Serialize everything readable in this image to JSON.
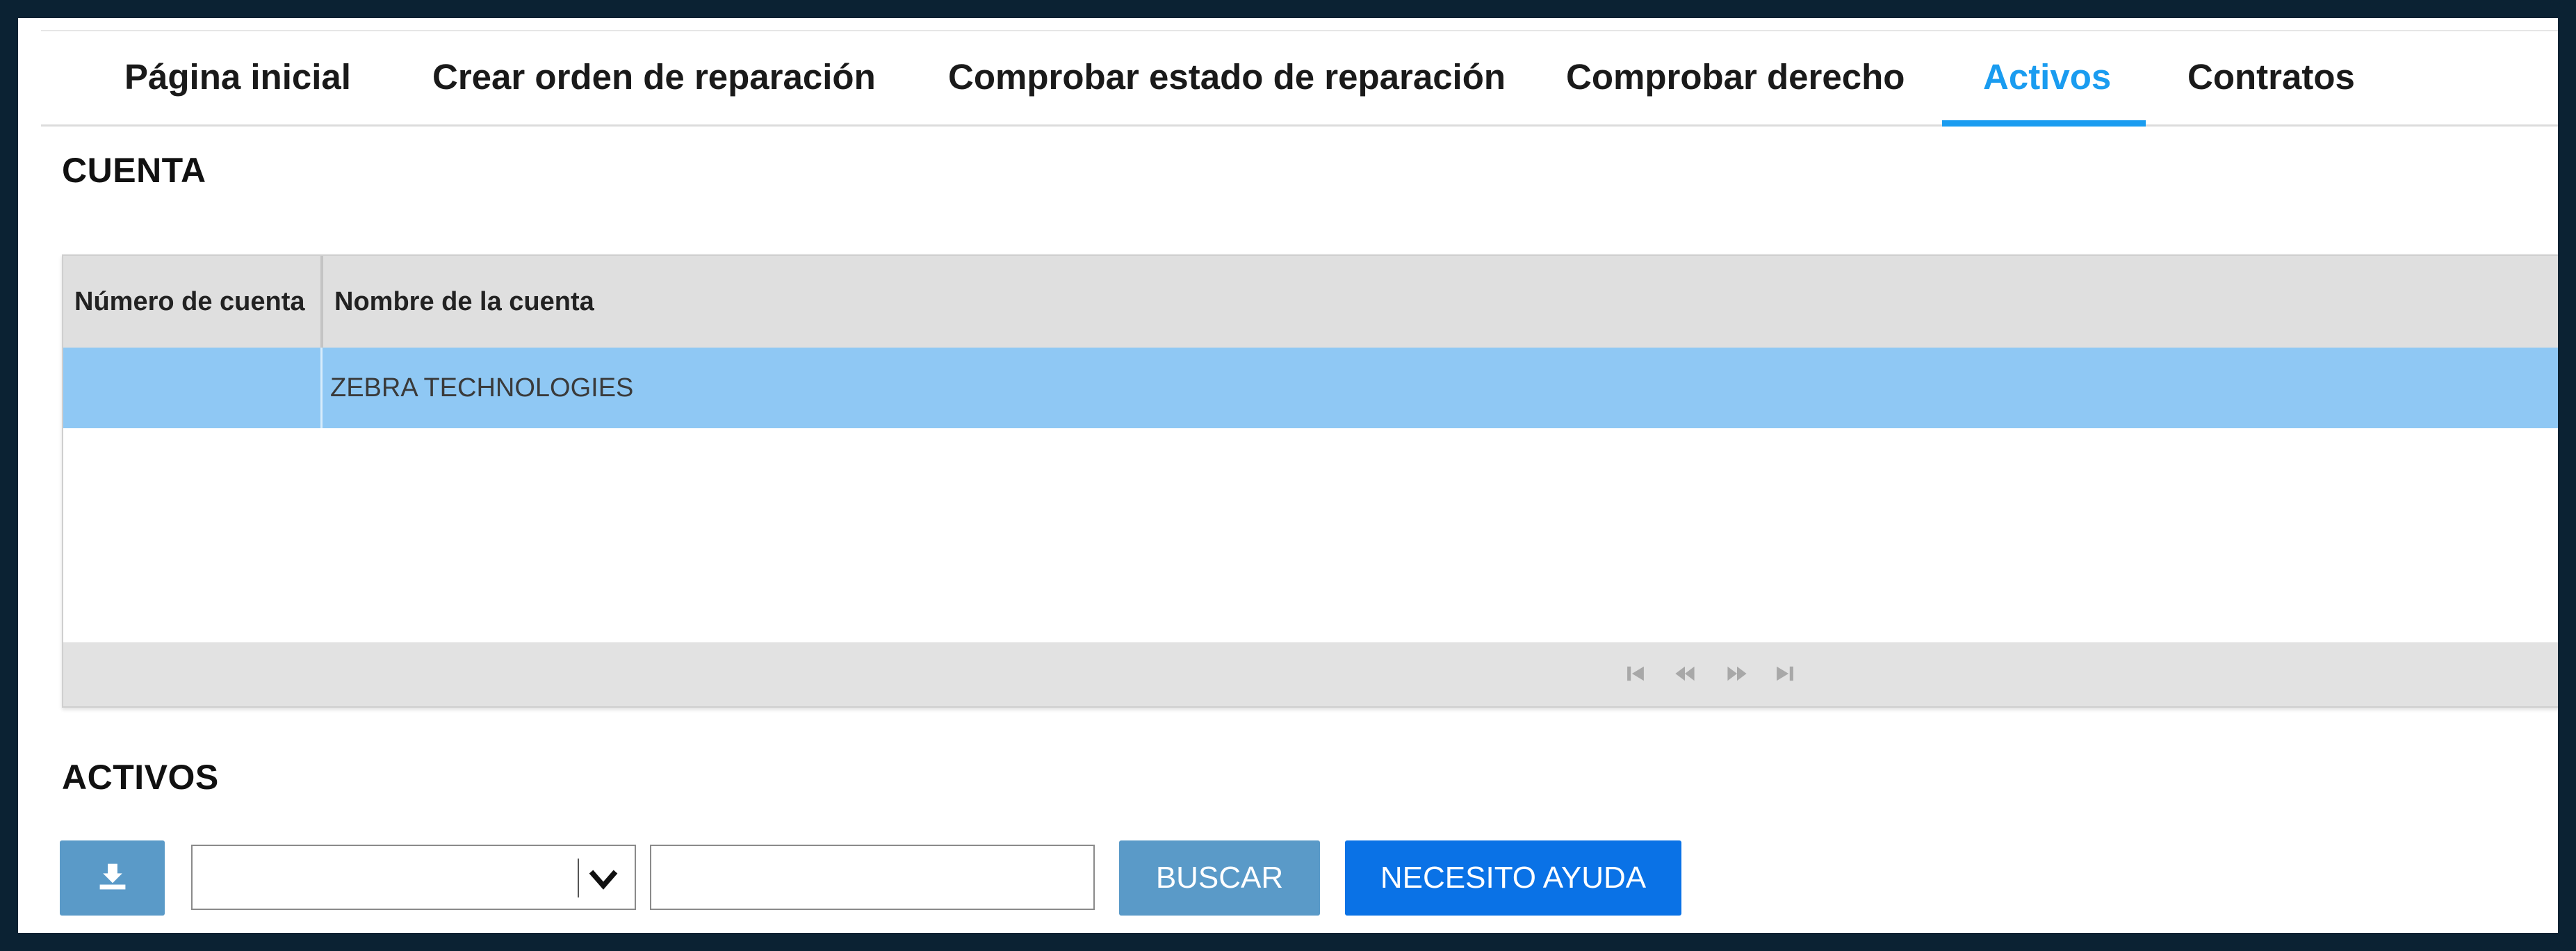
{
  "tabs": [
    {
      "label": "Página inicial"
    },
    {
      "label": "Crear orden de reparación"
    },
    {
      "label": "Comprobar estado de reparación"
    },
    {
      "label": "Comprobar derecho"
    },
    {
      "label": "Activos",
      "active": true
    },
    {
      "label": "Contratos"
    }
  ],
  "account_section": {
    "title": "CUENTA",
    "columns": [
      "Número de cuenta",
      "Nombre de la cuenta"
    ],
    "rows": [
      {
        "account_number": "",
        "account_name": "ZEBRA TECHNOLOGIES",
        "selected": true
      }
    ],
    "pager_icons": [
      "first-page-icon",
      "prev-page-icon",
      "next-page-icon",
      "last-page-icon"
    ]
  },
  "assets_section": {
    "title": "ACTIVOS",
    "download_icon": "download-icon",
    "filter_select_value": "",
    "search_value": "",
    "search_button": "BUSCAR",
    "help_button": "NECESITO AYUDA"
  },
  "colors": {
    "accent": "#1a9cf0",
    "selected_row": "#8fc8f4",
    "button_muted": "#5a9ac8",
    "button_primary": "#0a72e6"
  }
}
